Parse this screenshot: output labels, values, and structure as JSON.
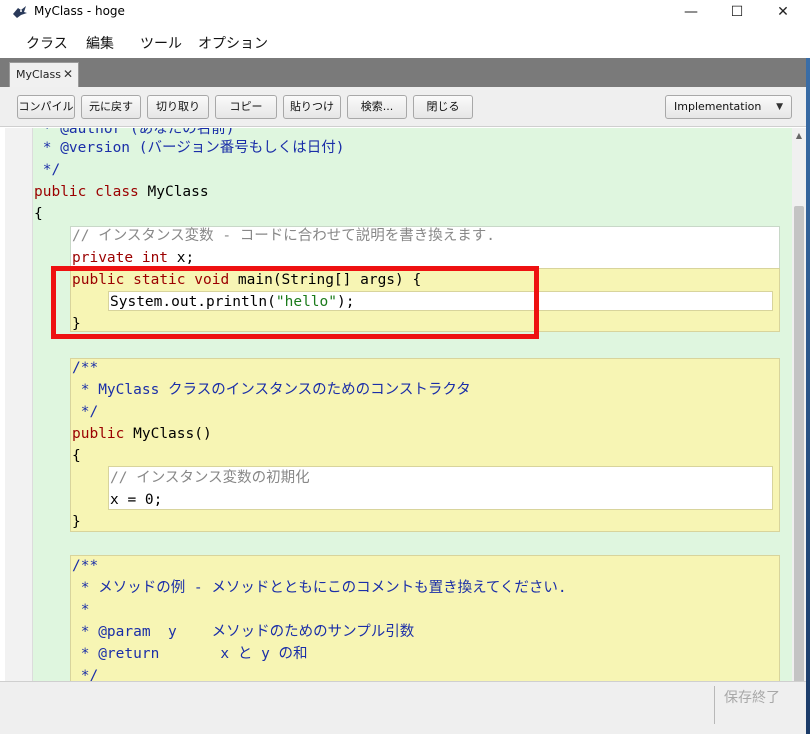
{
  "window": {
    "title": "MyClass - hoge",
    "minimize": "—",
    "maximize": "☐",
    "close": "✕"
  },
  "menu": [
    "クラス",
    "編集",
    "ツール",
    "オプション"
  ],
  "tab": {
    "label": "MyClass",
    "close": "✕"
  },
  "toolbar": {
    "buttons": [
      "コンパイル",
      "元に戻す",
      "切り取り",
      "コピー",
      "貼りつけ",
      "検索...",
      "閉じる"
    ],
    "view_select": "Implementation"
  },
  "code": {
    "line_author": " * @author (あなたの名前)",
    "line_version": " * @version (バージョン番号もしくは日付)",
    "line_end_comment": " */",
    "kw_public": "public",
    "kw_class": "class",
    "class_name": "MyClass",
    "brace_open": "{",
    "field_comment": "// インスタンス変数 - コードに合わせて説明を書き換えます.",
    "kw_private": "private",
    "kw_int": "int",
    "field_name": "x;",
    "kw_static": "static",
    "kw_void": "void",
    "main_sig": "main(String[] args) {",
    "println_call": "System.out.println(",
    "hello_str": "\"hello\"",
    "println_end": ");",
    "brace_close": "}",
    "doc_open": "/**",
    "ctor_doc": " * MyClass クラスのインスタンスのためのコンストラクタ",
    "doc_close": " */",
    "ctor_sig": "MyClass()",
    "ctor_comment": "// インスタンス変数の初期化",
    "ctor_assign": "x = 0;",
    "method_doc1": " * メソッドの例 - メソッドとともにこのコメントも置き換えてください.",
    "method_doc2": " *",
    "method_doc3": " * @param  y    メソッドのためのサンプル引数",
    "method_doc4": " * @return       x と y の和"
  },
  "status": {
    "save_state": "保存終了"
  }
}
